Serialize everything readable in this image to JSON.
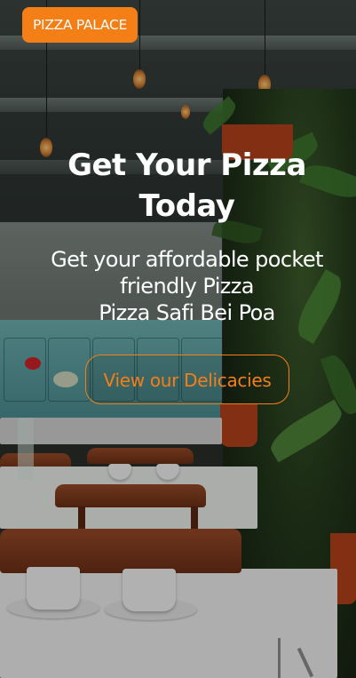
{
  "nav": {
    "brand_label": "PIZZA PALACE"
  },
  "hero": {
    "title_line1": "Get Your Pizza",
    "title_line2": "Today",
    "subtitle_line1": "Get your affordable pocket",
    "subtitle_line2": "friendly Pizza",
    "subtitle_line3": "Pizza Safi Bei Poa",
    "cta_label": "View our Delicacies"
  },
  "colors": {
    "accent": "#f57f17",
    "hero_text": "#ffffff"
  },
  "background": {
    "image_icon": "restaurant-interior-photo"
  }
}
